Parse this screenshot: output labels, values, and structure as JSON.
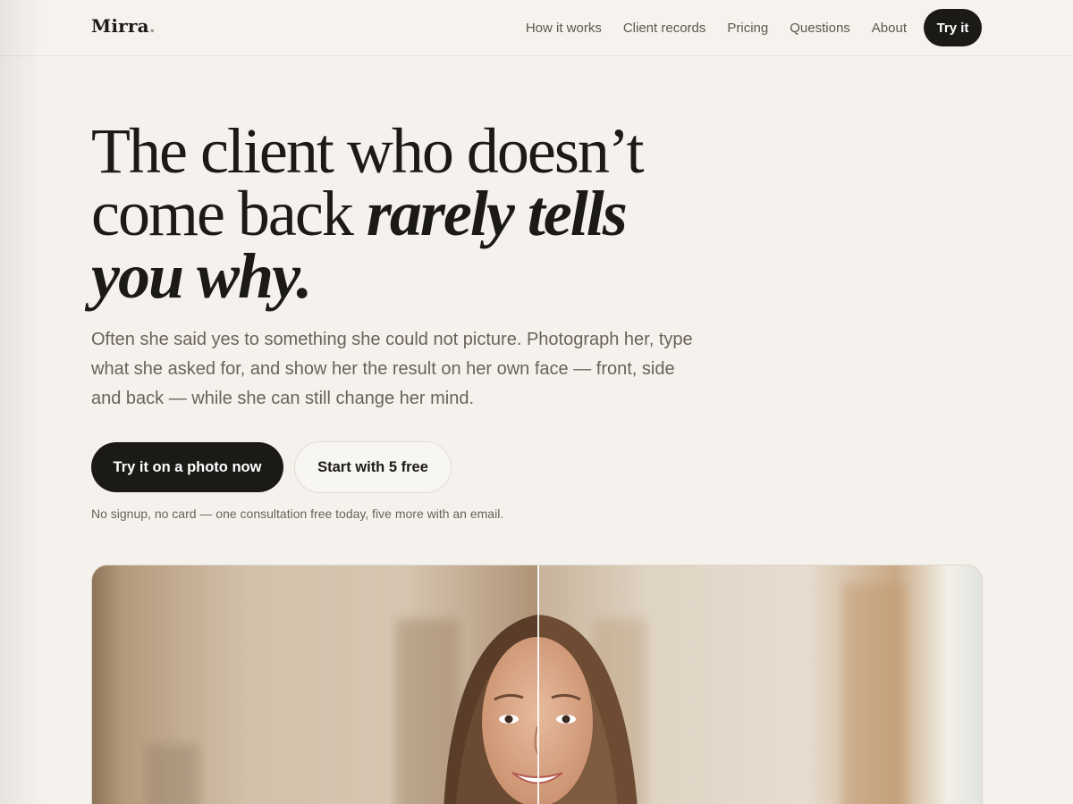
{
  "header": {
    "logo": "Mirra",
    "logo_dot": ".",
    "nav": [
      "How it works",
      "Client records",
      "Pricing",
      "Questions",
      "About"
    ],
    "cta": "Try it"
  },
  "hero": {
    "headline_line1": "The client who doesn’t",
    "headline_line2a": "come back ",
    "headline_line2b": "rarely tells",
    "headline_line3": "you why.",
    "lede": "Often she said yes to something she could not picture. Photograph her, type what she asked for, and show her the result on her own face — front, side and back — while she can still change her mind.",
    "primary_button": "Try it on a photo now",
    "secondary_button": "Start with 5 free",
    "note": "No signup, no card — one consultation free today, five more with an email."
  },
  "colors": {
    "background": "#f5f2ed",
    "ink": "#1c1a17",
    "muted": "#6a6259"
  },
  "compare_image": {
    "icon": "before-after-portrait"
  }
}
